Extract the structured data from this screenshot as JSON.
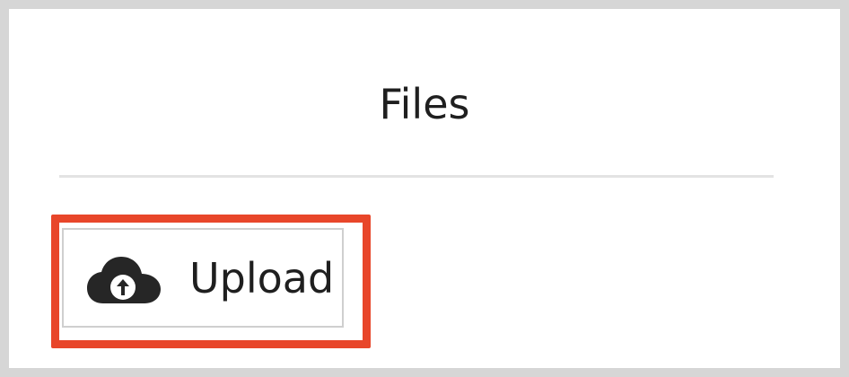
{
  "panel": {
    "title": "Files"
  },
  "upload_button": {
    "label": "Upload",
    "icon": "cloud-upload-icon"
  },
  "colors": {
    "highlight": "#e8462a",
    "frame": "#d6d6d6",
    "divider": "#e3e3e3",
    "text": "#1f1f1f",
    "icon": "#262626"
  }
}
